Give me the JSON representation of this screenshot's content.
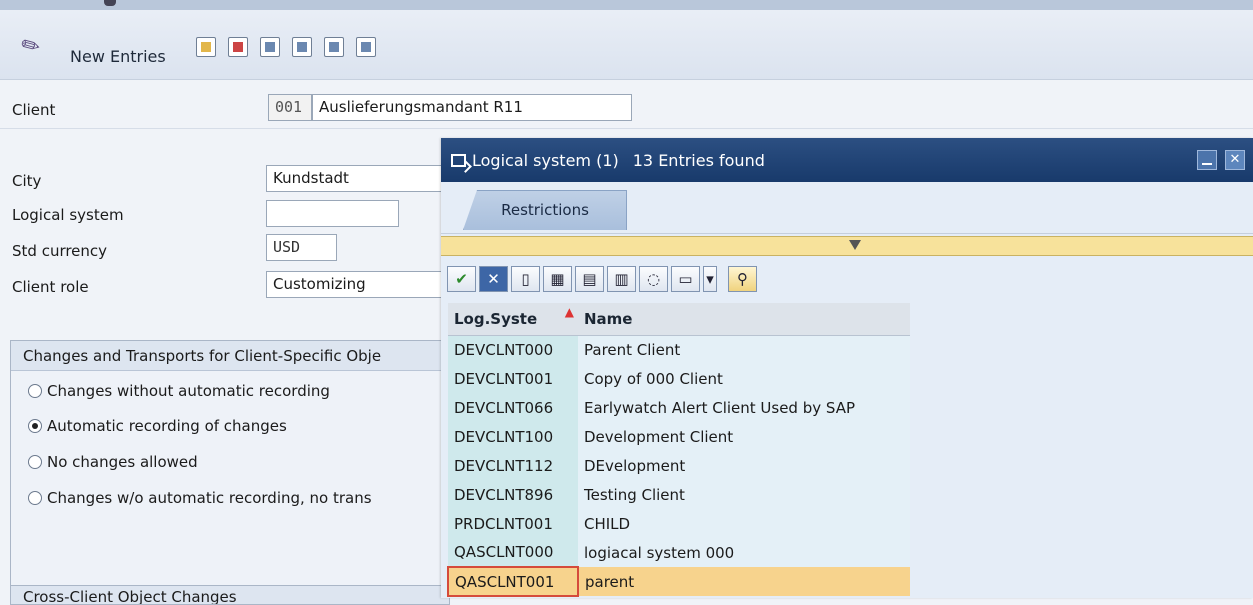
{
  "toolbar": {
    "new_entries": "New Entries"
  },
  "form": {
    "client_label": "Client",
    "client_code": "001",
    "client_desc": "Auslieferungsmandant R11",
    "city_label": "City",
    "city_value": "Kundstadt",
    "logical_system_label": "Logical system",
    "logical_system_value": "",
    "currency_label": "Std currency",
    "currency_value": "USD",
    "client_role_label": "Client role",
    "client_role_value": "Customizing"
  },
  "changes_group": {
    "title": "Changes and Transports for Client-Specific Obje",
    "options": [
      {
        "label": "Changes without automatic recording",
        "selected": false
      },
      {
        "label": "Automatic recording of changes",
        "selected": true
      },
      {
        "label": "No changes allowed",
        "selected": false
      },
      {
        "label": "Changes w/o automatic recording, no trans",
        "selected": false
      }
    ]
  },
  "cross_group": {
    "title": "Cross-Client Object Changes"
  },
  "dialog": {
    "title": "Logical system (1)",
    "entries": "13 Entries found",
    "tab_restrictions": "Restrictions",
    "columns": [
      "Log.Syste",
      "Name"
    ],
    "rows": [
      {
        "code": "DEVCLNT000",
        "name": "Parent Client",
        "selected": false
      },
      {
        "code": "DEVCLNT001",
        "name": "Copy  of 000 Client",
        "selected": false
      },
      {
        "code": "DEVCLNT066",
        "name": "Earlywatch Alert Client Used by SAP",
        "selected": false
      },
      {
        "code": "DEVCLNT100",
        "name": "Development Client",
        "selected": false
      },
      {
        "code": "DEVCLNT112",
        "name": "DEvelopment",
        "selected": false
      },
      {
        "code": "DEVCLNT896",
        "name": "Testing Client",
        "selected": false
      },
      {
        "code": "PRDCLNT001",
        "name": "CHILD",
        "selected": false
      },
      {
        "code": "QASCLNT000",
        "name": "logiacal system 000",
        "selected": false
      },
      {
        "code": "QASCLNT001",
        "name": "parent",
        "selected": true
      }
    ]
  }
}
